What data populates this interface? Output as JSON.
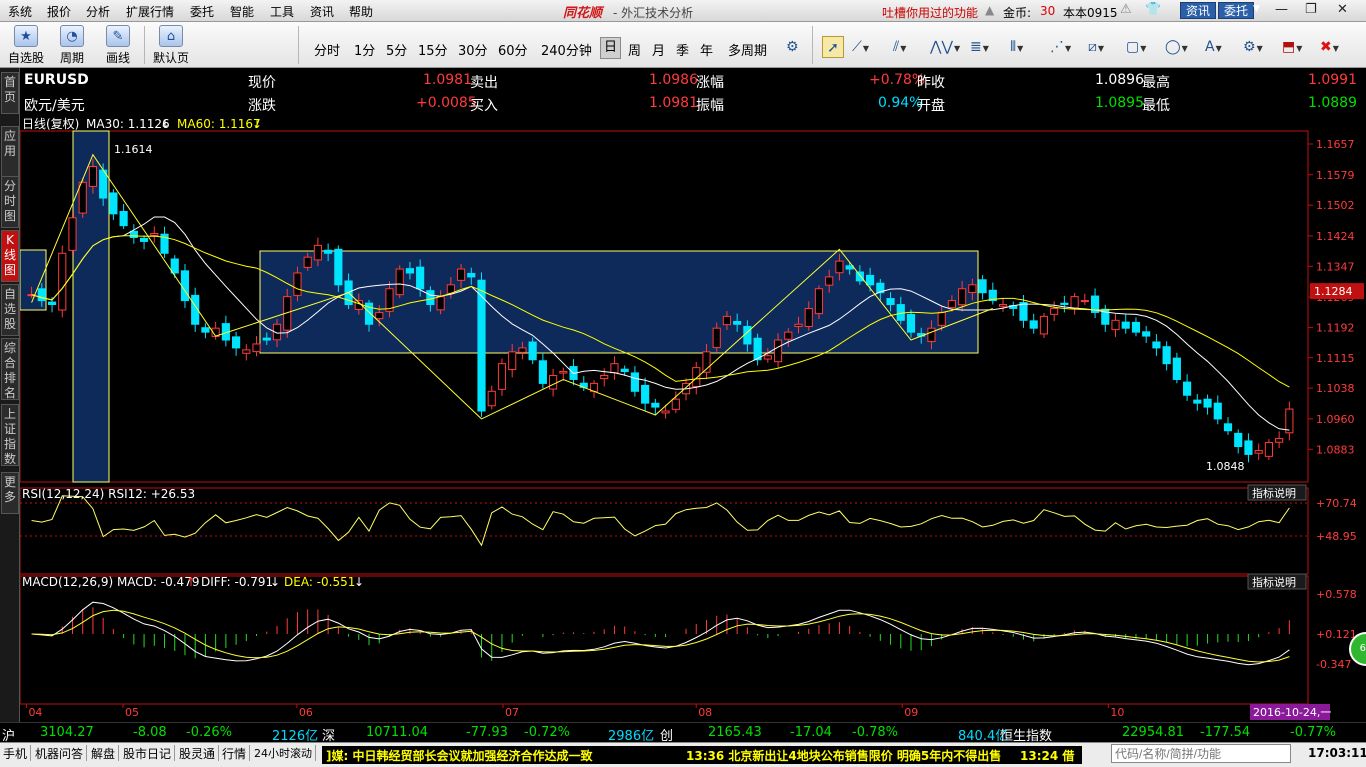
{
  "menu": {
    "items": [
      "系统",
      "报价",
      "分析",
      "扩展行情",
      "委托",
      "智能",
      "工具",
      "资讯",
      "帮助"
    ],
    "brand": "同花顺",
    "app_title": "- 外汇技术分析",
    "feedback": "吐槽你用过的功能",
    "coins_label": "金币:",
    "coins_value": "30",
    "version": "本本0915",
    "news_btn": "资讯",
    "trade_btn": "委托"
  },
  "toolbar": {
    "big_buttons": [
      {
        "label": "自选股",
        "icon": "star-icon"
      },
      {
        "label": "周期",
        "icon": "clock-icon"
      },
      {
        "label": "画线",
        "icon": "pencil-icon"
      },
      {
        "label": "默认页",
        "icon": "home-icon"
      }
    ],
    "periods": [
      "分时",
      "1分",
      "5分",
      "15分",
      "30分",
      "60分",
      "240分钟",
      "日",
      "周",
      "月",
      "季",
      "年",
      "多周期"
    ],
    "active_period": "日"
  },
  "leftnav": [
    "首页",
    "应用",
    "分时图",
    "K线图",
    "自选股",
    "综合排名",
    "上证指数",
    "更多"
  ],
  "quote": {
    "symbol": "EURUSD",
    "name": "欧元/美元",
    "labels": {
      "price": "现价",
      "sell": "卖出",
      "pct": "涨幅",
      "prev_close": "昨收",
      "high": "最高",
      "chg": "涨跌",
      "buy": "买入",
      "amp": "振幅",
      "open": "开盘",
      "low": "最低"
    },
    "price": "1.0981",
    "sell": "1.0986",
    "pct": "+0.78%",
    "prev_close": "1.0896",
    "high": "1.0991",
    "chg": "+0.0085",
    "buy": "1.0981",
    "amp": "0.94%",
    "open": "1.0895",
    "low": "1.0889"
  },
  "chart_data": {
    "type": "candlestick",
    "main_label": "日线(复权)",
    "ma30_label": "MA30: 1.1126",
    "ma60_label": "MA60: 1.1167",
    "ylim": [
      1.08,
      1.169
    ],
    "y_ticks": [
      "1.1657",
      "1.1579",
      "1.1502",
      "1.1424",
      "1.1347",
      "1.1269",
      "1.1192",
      "1.1115",
      "1.1038",
      "1.0960",
      "1.0883"
    ],
    "current_price_tag": "1.1284",
    "max_label": "1.1614",
    "min_label": "1.0848",
    "x_labels": [
      "04",
      "05",
      "06",
      "07",
      "08",
      "09",
      "10"
    ],
    "last_date": "2016-10-24,一",
    "rsi_label": "RSI(12,12,24) RSI12: +26.53",
    "rsi_ticks": [
      "+70.74",
      "+48.95"
    ],
    "macd_label": "MACD(12,26,9) MACD: -0.479",
    "macd_diff": "DIFF: -0.791",
    "macd_dea": "DEA: -0.551",
    "macd_ticks": [
      "+0.578",
      "+0.121",
      "-0.347"
    ],
    "indicator_btn": "指标说明",
    "colors": {
      "up": "#ff3b3b",
      "down": "#00e5ff",
      "ma30": "#ffffff",
      "ma60": "#ffff00",
      "box": "#0d2a5a"
    }
  },
  "status": {
    "sh_label": "沪",
    "sh_price": "3104.27",
    "sh_chg": "-8.08",
    "sh_pct": "-0.26%",
    "sh_amt": "2126亿",
    "sz_label": "深",
    "sz_price": "10711.04",
    "sz_chg": "-77.93",
    "sz_pct": "-0.72%",
    "sz_amt": "2986亿",
    "cy_label": "创",
    "cy_price": "2165.43",
    "cy_chg": "-17.04",
    "cy_pct": "-0.78%",
    "cy_amt": "840.4亿",
    "hs_label": "恒生指数",
    "hs_price": "22954.81",
    "hs_chg": "-177.54",
    "hs_pct": "-0.77%"
  },
  "bottom": {
    "tabs": [
      "手机",
      "机器问答",
      "解盘",
      "股市日记",
      "股灵通",
      "行情",
      "24小时滚动"
    ],
    "ticker1": "]媒: 中日韩经贸部长会议就加强经济合作达成一致",
    "ticker2": "13:36 北京新出让4地块公布销售限价 明确5年内不得出售",
    "ticker3": "13:24 借",
    "search_placeholder": "代码/名称/简拼/功能",
    "clock": "17:03:11"
  }
}
